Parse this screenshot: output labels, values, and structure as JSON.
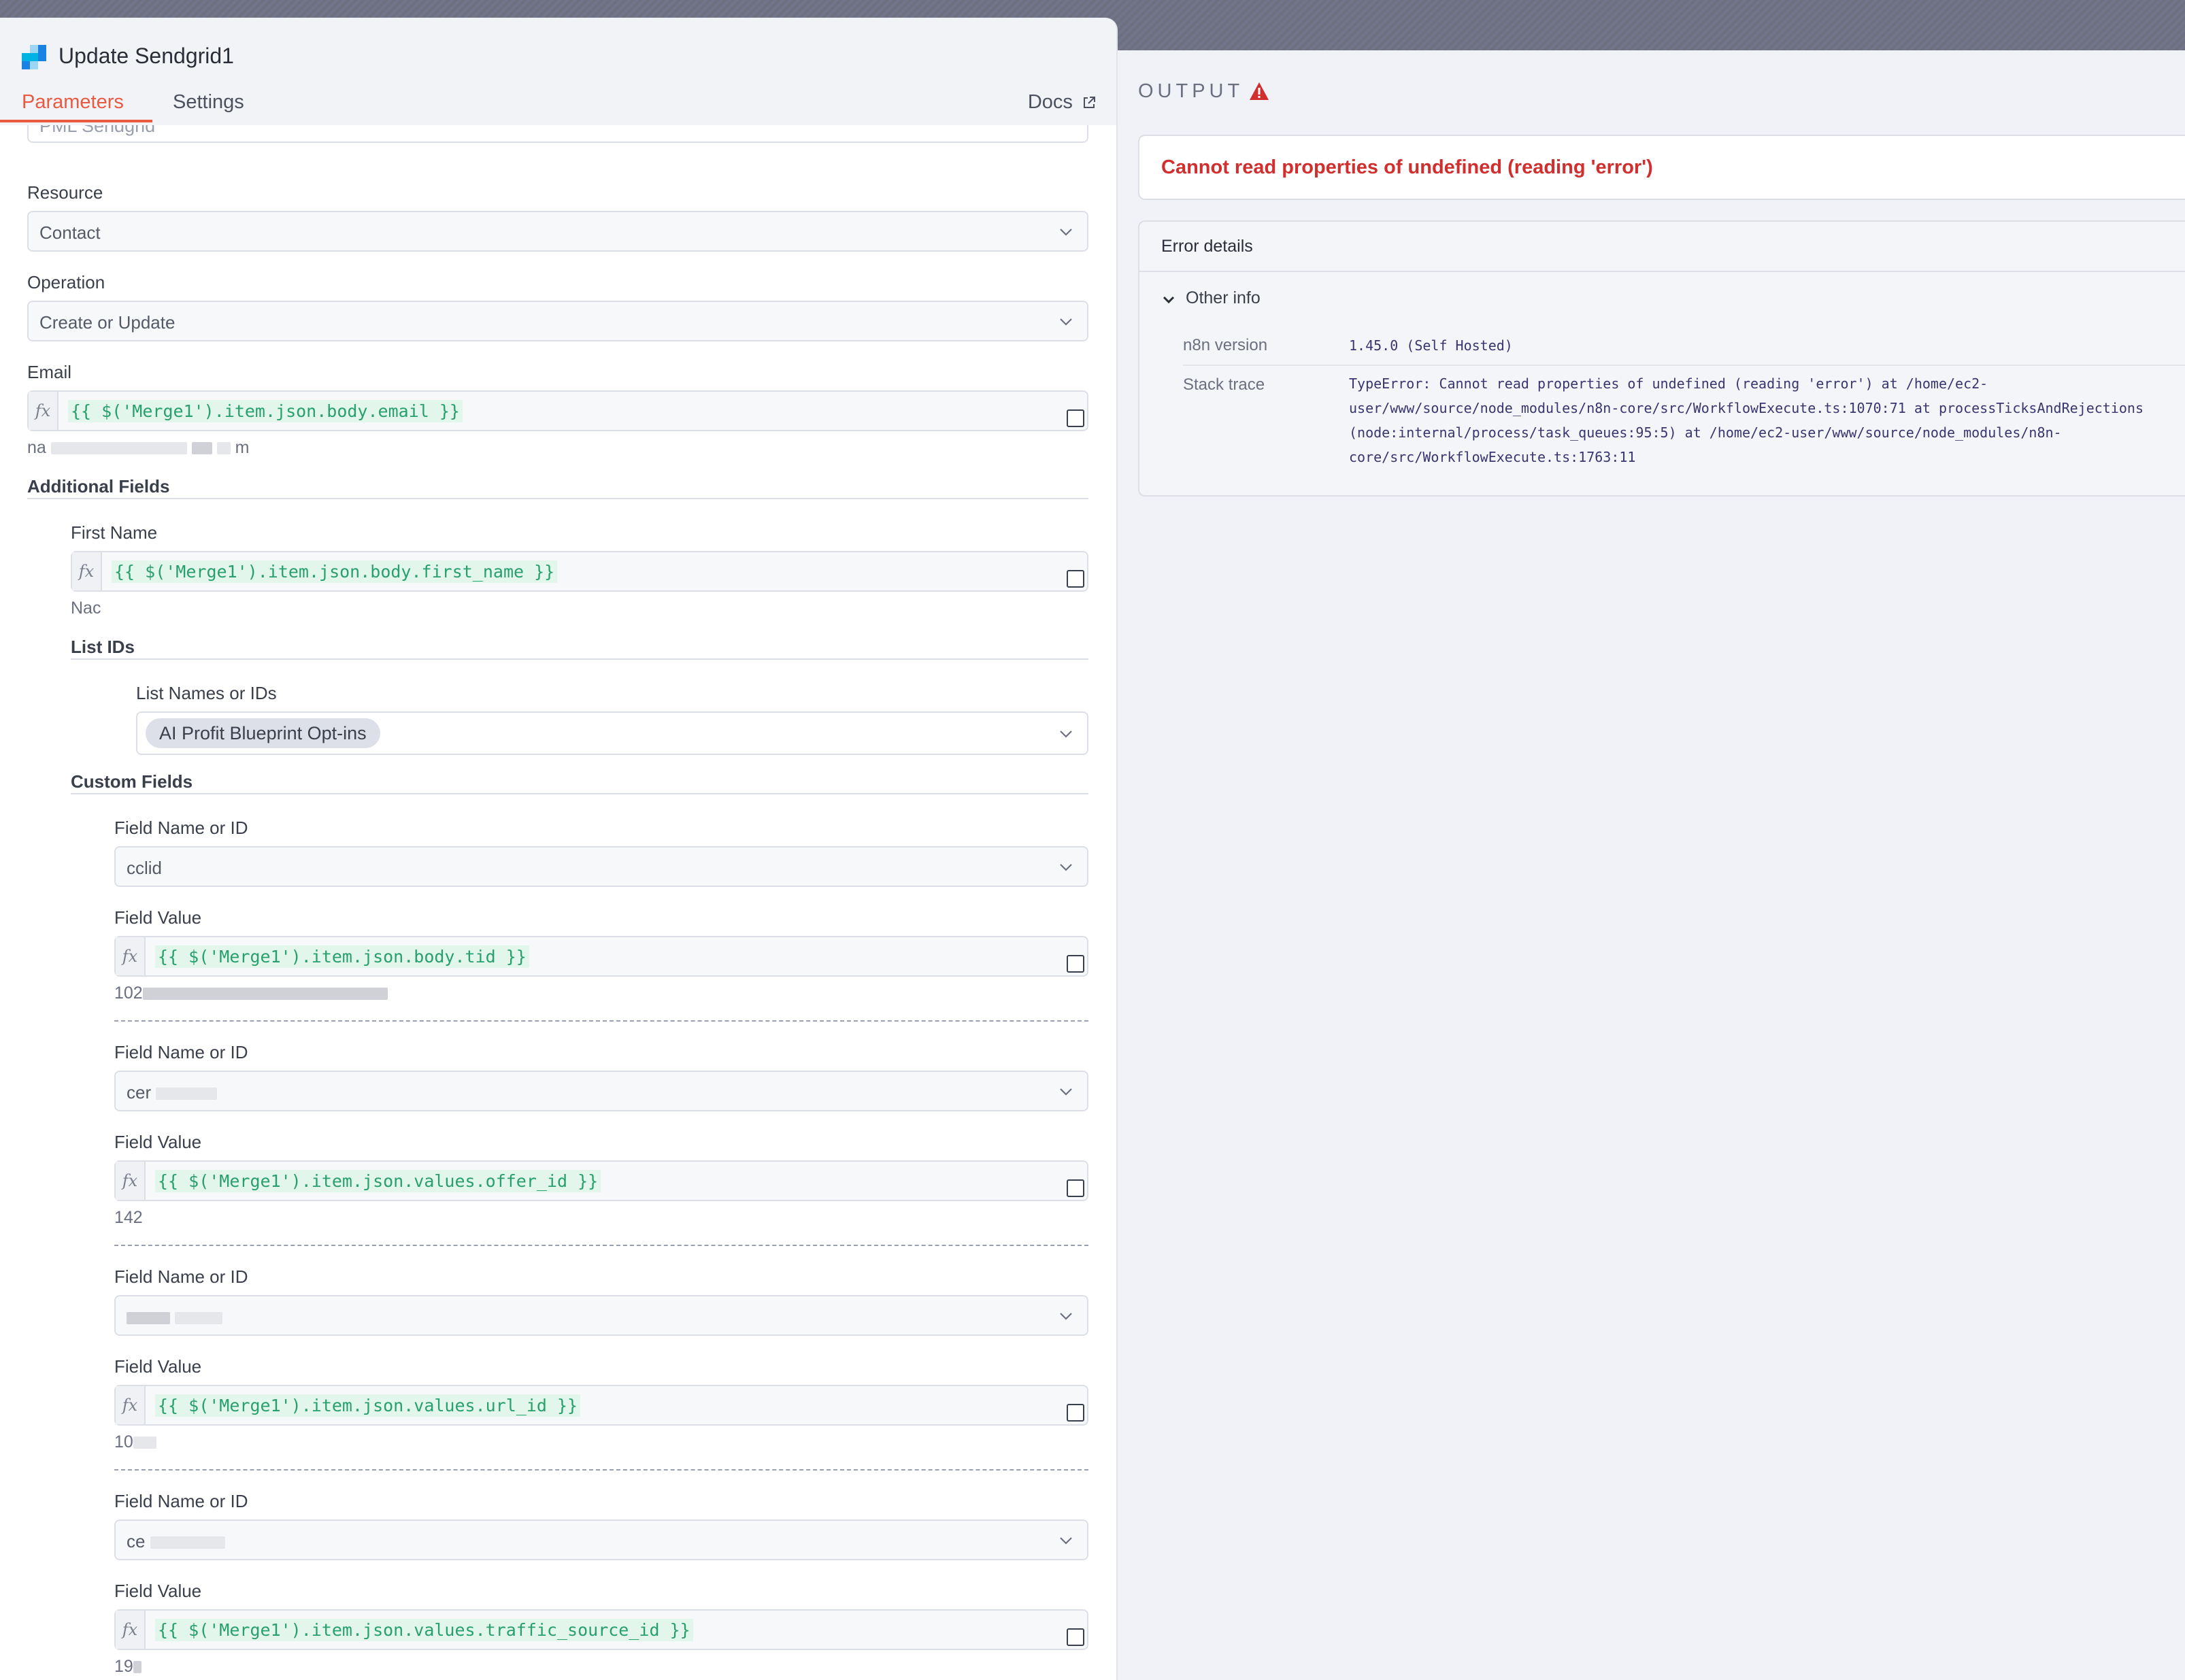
{
  "node": {
    "title": "Update Sendgrid1",
    "tabs": {
      "parameters": "Parameters",
      "settings": "Settings"
    },
    "docs_label": "Docs",
    "credential_value": "PML Sendgrid"
  },
  "form": {
    "resource": {
      "label": "Resource",
      "value": "Contact"
    },
    "operation": {
      "label": "Operation",
      "value": "Create or Update"
    },
    "email": {
      "label": "Email",
      "expression": "{{ $('Merge1').item.json.body.email }}",
      "preview_start": "na",
      "preview_end": "m"
    },
    "additional_fields": {
      "label": "Additional Fields",
      "first_name": {
        "label": "First Name",
        "expression": "{{ $('Merge1').item.json.body.first_name }}",
        "preview": "Nac"
      },
      "list_ids": {
        "section_label": "List IDs",
        "label": "List Names or IDs",
        "chip": "AI Profit Blueprint Opt-ins"
      },
      "custom_fields": {
        "label": "Custom Fields",
        "name_label": "Field Name or ID",
        "value_label": "Field Value",
        "items": [
          {
            "name": "cclid",
            "expression": "{{ $('Merge1').item.json.body.tid }}",
            "preview": "102"
          },
          {
            "name": "cer",
            "expression": "{{ $('Merge1').item.json.values.offer_id }}",
            "preview": "142"
          },
          {
            "name": "",
            "expression": "{{ $('Merge1').item.json.values.url_id }}",
            "preview": "10"
          },
          {
            "name": "ce",
            "expression": "{{ $('Merge1').item.json.values.traffic_source_id }}",
            "preview": "19"
          }
        ]
      }
    }
  },
  "output": {
    "title": "OUTPUT",
    "error_message": "Cannot read properties of undefined (reading 'error')",
    "details": {
      "heading": "Error details",
      "other_info": "Other info",
      "version_key": "n8n version",
      "version_value": "1.45.0 (Self Hosted)",
      "stack_key": "Stack trace",
      "stack_lines": [
        "TypeError: Cannot read properties of undefined (reading 'error') at /home/ec2-",
        "user/www/source/node_modules/n8n-core/src/WorkflowExecute.ts:1070:71 at processTicksAndRejections",
        "(node:internal/process/task_queues:95:5) at /home/ec2-user/www/source/node_modules/n8n-",
        "core/src/WorkflowExecute.ts:1763:11"
      ]
    },
    "colors": {
      "error": "#d12e2e",
      "accent": "#ea5a41",
      "expression": "#28a06c"
    }
  }
}
